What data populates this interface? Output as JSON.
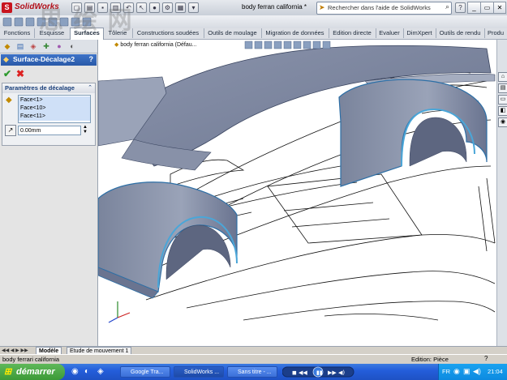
{
  "titlebar": {
    "app_name": "SolidWorks",
    "document_title": "body ferran california *",
    "search_placeholder": "Rechercher dans l'aide de SolidWorks"
  },
  "tabs": [
    "Fonctions",
    "Esquisse",
    "Surfaces",
    "Tôlerie",
    "Constructions soudées",
    "Outils de moulage",
    "Migration de données",
    "Edition directe",
    "Evaluer",
    "DimXpert",
    "Outils de rendu",
    "Produ"
  ],
  "active_tab": "Surfaces",
  "feature": {
    "title": "Surface-Décalage2",
    "help": "?",
    "group_title": "Paramètres de décalage",
    "faces": [
      "Face<1>",
      "Face<10>",
      "Face<11>"
    ],
    "distance": "0.00mm"
  },
  "viewport": {
    "tree_label": "body ferran california (Défau..."
  },
  "bottom_tabs": [
    "Modèle",
    "Etude de mouvement 1"
  ],
  "status": {
    "left": "body ferrari california",
    "mode": "Edition: Pièce"
  },
  "taskbar": {
    "start": "démarrer",
    "items": [
      "Google Tra...",
      "SolidWorks ...",
      "Sans titre - ..."
    ],
    "lang": "FR",
    "clock": "21:04"
  },
  "watermark": "思 绘 网",
  "colors": {
    "accent": "#2a5aa8",
    "surface": "#7f8aa3",
    "edge": "#4aa6d8"
  }
}
